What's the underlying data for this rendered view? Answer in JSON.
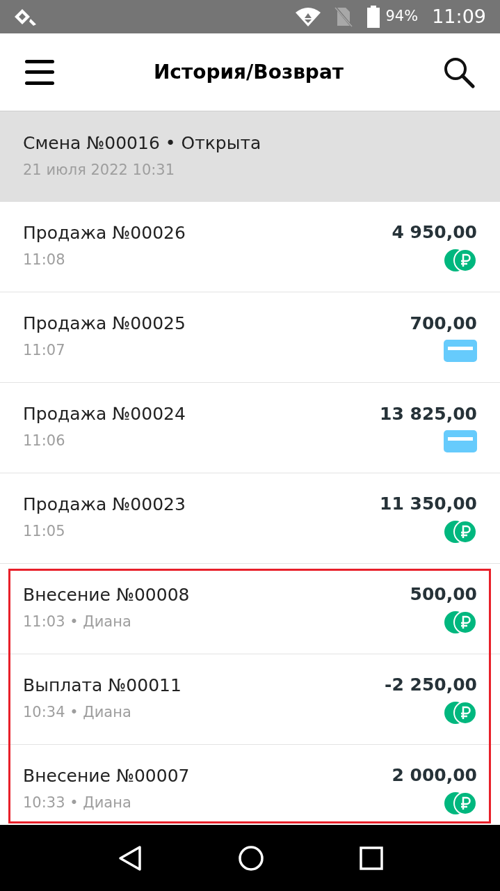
{
  "status_bar": {
    "battery": "94%",
    "time": "11:09"
  },
  "header": {
    "title": "История/Возврат"
  },
  "shift": {
    "title": "Смена №00016 • Открыта",
    "date": "21 июля 2022 10:31"
  },
  "rows": [
    {
      "title": "Продажа №00026",
      "time": "11:08",
      "amount": "4 950,00",
      "kind": "cash",
      "highlighted": false
    },
    {
      "title": "Продажа №00025",
      "time": "11:07",
      "amount": "700,00",
      "kind": "card",
      "highlighted": false
    },
    {
      "title": "Продажа №00024",
      "time": "11:06",
      "amount": "13 825,00",
      "kind": "card",
      "highlighted": false
    },
    {
      "title": "Продажа №00023",
      "time": "11:05",
      "amount": "11 350,00",
      "kind": "cash",
      "highlighted": false
    },
    {
      "title": "Внесение №00008",
      "time": "11:03 • Диана",
      "amount": "500,00",
      "kind": "cash",
      "highlighted": true
    },
    {
      "title": "Выплата №00011",
      "time": "10:34 • Диана",
      "amount": "-2 250,00",
      "kind": "cash",
      "highlighted": true
    },
    {
      "title": "Внесение №00007",
      "time": "10:33 • Диана",
      "amount": "2 000,00",
      "kind": "cash",
      "highlighted": true
    }
  ]
}
